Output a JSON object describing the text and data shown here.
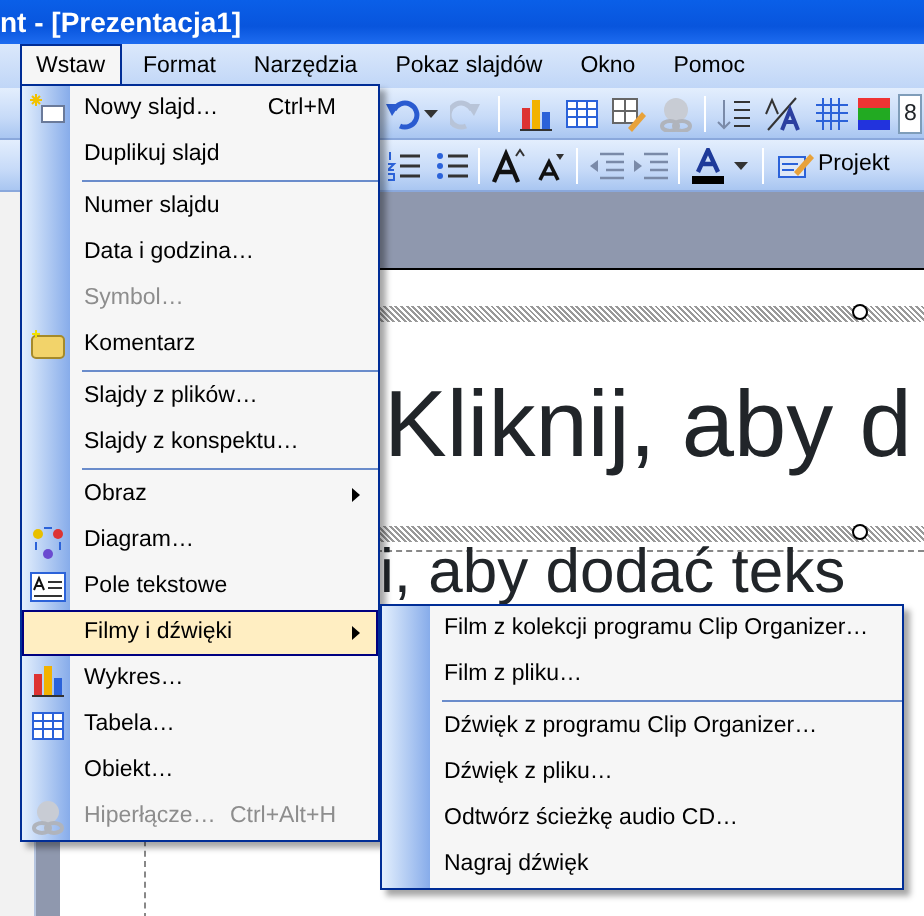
{
  "window": {
    "title": "nt - [Prezentacja1]"
  },
  "menubar": [
    {
      "label": "Wstaw",
      "selected": true
    },
    {
      "label": "Format",
      "selected": false
    },
    {
      "label": "Narzędzia",
      "selected": false
    },
    {
      "label": "Pokaz slajdów",
      "selected": false
    },
    {
      "label": "Okno",
      "selected": false
    },
    {
      "label": "Pomoc",
      "selected": false
    }
  ],
  "toolbar": {
    "zoom_field": {
      "value": "8"
    },
    "design_button": {
      "label": "Projekt"
    }
  },
  "slide": {
    "title": "Kliknij, aby d",
    "subtitle": "i, aby dodać teks"
  },
  "insert_menu": [
    {
      "kind": "item",
      "label": "Nowy slajd…",
      "shortcut": "Ctrl+M",
      "disabled": false,
      "selected": false,
      "submenu": false
    },
    {
      "kind": "item",
      "label": "Duplikuj slajd",
      "disabled": false,
      "selected": false,
      "submenu": false
    },
    {
      "kind": "separator"
    },
    {
      "kind": "item",
      "label": "Numer slajdu",
      "disabled": false,
      "selected": false,
      "submenu": false
    },
    {
      "kind": "item",
      "label": "Data i godzina…",
      "disabled": false,
      "selected": false,
      "submenu": false
    },
    {
      "kind": "item",
      "label": "Symbol…",
      "disabled": true,
      "selected": false,
      "submenu": false
    },
    {
      "kind": "item",
      "label": "Komentarz",
      "disabled": false,
      "selected": false,
      "submenu": false
    },
    {
      "kind": "separator"
    },
    {
      "kind": "item",
      "label": "Slajdy z plików…",
      "disabled": false,
      "selected": false,
      "submenu": false
    },
    {
      "kind": "item",
      "label": "Slajdy z konspektu…",
      "disabled": false,
      "selected": false,
      "submenu": false
    },
    {
      "kind": "separator"
    },
    {
      "kind": "item",
      "label": "Obraz",
      "disabled": false,
      "selected": false,
      "submenu": true
    },
    {
      "kind": "item",
      "label": "Diagram…",
      "disabled": false,
      "selected": false,
      "submenu": false
    },
    {
      "kind": "item",
      "label": "Pole tekstowe",
      "disabled": false,
      "selected": false,
      "submenu": false
    },
    {
      "kind": "item",
      "label": "Filmy i dźwięki",
      "disabled": false,
      "selected": true,
      "submenu": true
    },
    {
      "kind": "item",
      "label": "Wykres…",
      "disabled": false,
      "selected": false,
      "submenu": false
    },
    {
      "kind": "item",
      "label": "Tabela…",
      "disabled": false,
      "selected": false,
      "submenu": false
    },
    {
      "kind": "item",
      "label": "Obiekt…",
      "disabled": false,
      "selected": false,
      "submenu": false
    },
    {
      "kind": "item",
      "label": "Hiperłącze…",
      "shortcut": "Ctrl+Alt+H",
      "disabled": true,
      "selected": false,
      "submenu": false
    }
  ],
  "media_submenu": [
    {
      "kind": "item",
      "label": "Film z kolekcji programu Clip Organizer…",
      "disabled": false,
      "selected": false
    },
    {
      "kind": "item",
      "label": "Film z pliku…",
      "disabled": false,
      "selected": false
    },
    {
      "kind": "separator"
    },
    {
      "kind": "item",
      "label": "Dźwięk z programu Clip Organizer…",
      "disabled": false,
      "selected": false
    },
    {
      "kind": "item",
      "label": "Dźwięk z pliku…",
      "disabled": false,
      "selected": false
    },
    {
      "kind": "item",
      "label": "Odtwórz ścieżkę audio CD…",
      "disabled": false,
      "selected": false
    },
    {
      "kind": "item",
      "label": "Nagraj dźwięk",
      "disabled": false,
      "selected": false
    }
  ]
}
